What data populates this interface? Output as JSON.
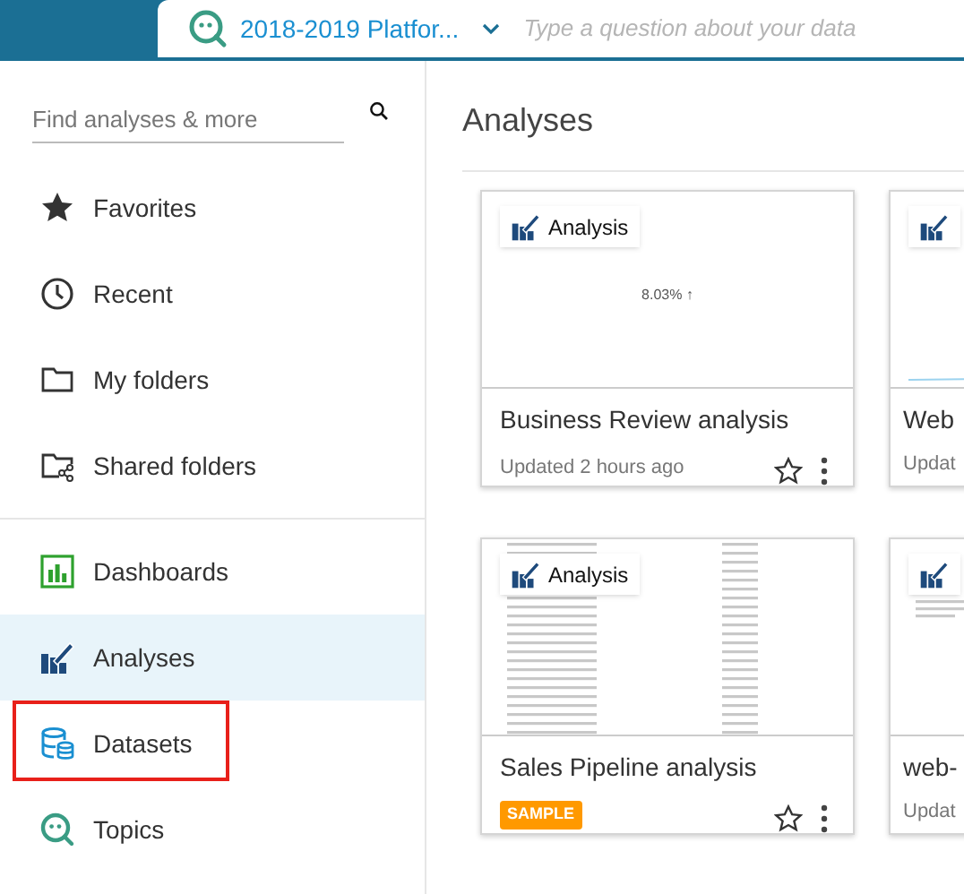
{
  "top_bar": {
    "topic": "2018-2019 Platfor...",
    "question_placeholder": "Type a question about your data"
  },
  "sidebar": {
    "search": {
      "placeholder": "Find analyses & more"
    },
    "items": [
      {
        "kind": "favorites",
        "label": "Favorites",
        "selected": false,
        "highlighted": false
      },
      {
        "kind": "recent",
        "label": "Recent",
        "selected": false,
        "highlighted": false
      },
      {
        "kind": "folder",
        "label": "My folders",
        "selected": false,
        "highlighted": false
      },
      {
        "kind": "shared",
        "label": "Shared folders",
        "selected": false,
        "highlighted": false
      },
      {
        "kind": "dashboards",
        "label": "Dashboards",
        "selected": false,
        "highlighted": false
      },
      {
        "kind": "analyses",
        "label": "Analyses",
        "selected": true,
        "highlighted": false
      },
      {
        "kind": "datasets",
        "label": "Datasets",
        "selected": false,
        "highlighted": true
      },
      {
        "kind": "topics",
        "label": "Topics",
        "selected": false,
        "highlighted": false
      }
    ]
  },
  "main": {
    "title": "Analyses",
    "cards": [
      {
        "kind": "kpi",
        "preview_text": "8.03% ↑",
        "badge": "Analysis",
        "title": "Business Review analysis",
        "subtitle": "Updated 2 hours ago",
        "sample": false,
        "favorite": false
      },
      {
        "kind": "line",
        "title": "Web",
        "subtitle": "Updat",
        "sample": false
      },
      {
        "kind": "table",
        "badge": "Analysis",
        "title": "Sales Pipeline analysis",
        "sample": true,
        "sample_label": "SAMPLE",
        "favorite": false
      },
      {
        "kind": "list",
        "title": "web-",
        "subtitle": "Updat",
        "sample": false
      }
    ]
  }
}
